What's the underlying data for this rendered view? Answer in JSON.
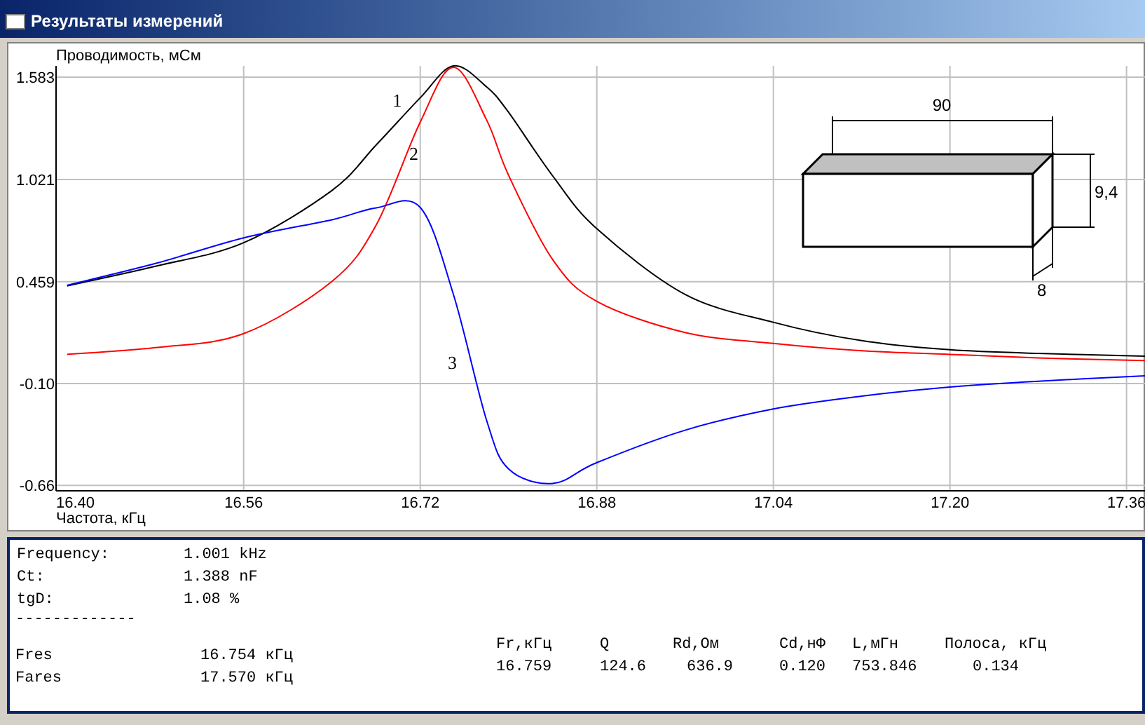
{
  "window": {
    "title": "Результаты измерений"
  },
  "chart": {
    "chart_data": {
      "type": "line",
      "grid": true,
      "ylabel": "Проводимость, мСм",
      "xlabel": "Частота, кГц",
      "xlim": [
        16.39,
        17.378
      ],
      "ylim": [
        -0.69,
        1.645
      ],
      "xticks": [
        {
          "value": 16.4,
          "label": "16.40"
        },
        {
          "value": 16.56,
          "label": "16.56"
        },
        {
          "value": 16.72,
          "label": "16.72"
        },
        {
          "value": 16.88,
          "label": "16.88"
        },
        {
          "value": 17.04,
          "label": "17.04"
        },
        {
          "value": 17.2,
          "label": "17.20"
        },
        {
          "value": 17.36,
          "label": "17.36"
        }
      ],
      "yticks": [
        {
          "value": 1.583,
          "label": "1.583"
        },
        {
          "value": 1.021,
          "label": "1.021"
        },
        {
          "value": 0.459,
          "label": "0.459"
        },
        {
          "value": -0.1,
          "label": "-0.10"
        },
        {
          "value": -0.66,
          "label": "-0.66"
        }
      ],
      "x": [
        16.4,
        16.48,
        16.56,
        16.64,
        16.68,
        16.72,
        16.75,
        16.78,
        16.8,
        16.84,
        16.88,
        16.96,
        17.04,
        17.12,
        17.2,
        17.28,
        17.378
      ],
      "series": [
        {
          "name": "1",
          "color": "#000000",
          "values": [
            0.436,
            0.544,
            0.673,
            0.961,
            1.21,
            1.47,
            1.645,
            1.53,
            1.39,
            1.04,
            0.75,
            0.39,
            0.236,
            0.135,
            0.085,
            0.065,
            0.05
          ]
        },
        {
          "name": "2",
          "color": "#ff0000",
          "values": [
            0.06,
            0.097,
            0.174,
            0.461,
            0.77,
            1.337,
            1.637,
            1.35,
            1.044,
            0.58,
            0.351,
            0.18,
            0.12,
            0.08,
            0.06,
            0.04,
            0.025
          ]
        },
        {
          "name": "3",
          "color": "#0000ff",
          "values": [
            0.44,
            0.559,
            0.7,
            0.8,
            0.865,
            0.867,
            0.39,
            -0.3,
            -0.57,
            -0.65,
            -0.535,
            -0.357,
            -0.24,
            -0.17,
            -0.12,
            -0.088,
            -0.057
          ]
        }
      ]
    },
    "inset_drawing": {
      "length_label": "90",
      "height_label": "9,4",
      "depth_label": "8"
    }
  },
  "results": {
    "lines": [
      {
        "label": "Frequency:",
        "value": "1.001 kHz"
      },
      {
        "label": "Ct:",
        "value": "1.388 nF"
      },
      {
        "label": "tgD:",
        "value": "1.08 %"
      }
    ],
    "separator": "-------------",
    "resonances": [
      {
        "label": "Fres",
        "value": "16.754 кГц"
      },
      {
        "label": "Fares",
        "value": "17.570 кГц"
      }
    ],
    "table": {
      "columns": [
        "Fr,кГц",
        "Q",
        "Rd,Ом",
        "Cd,нФ",
        "L,мГн",
        "Полоса, кГц"
      ],
      "rows": [
        [
          "16.759",
          "124.6",
          "636.9",
          "0.120",
          "753.846",
          "0.134"
        ]
      ]
    }
  }
}
